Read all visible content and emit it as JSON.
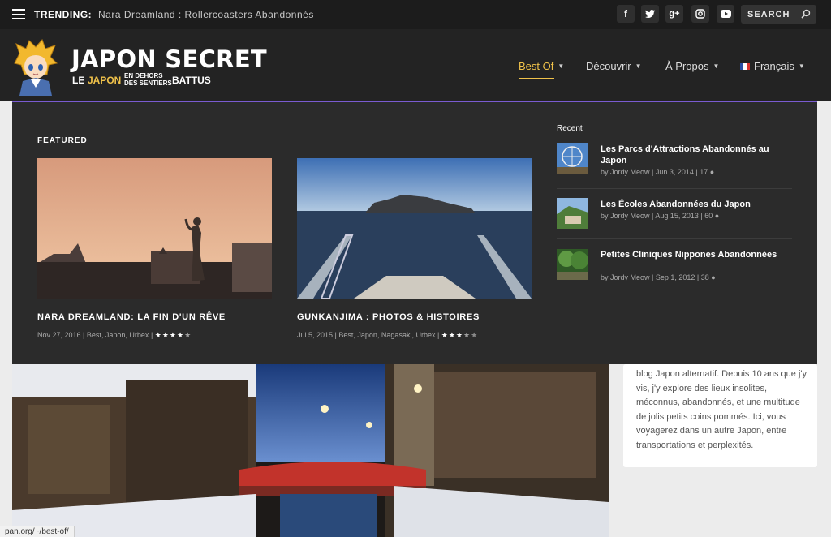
{
  "topbar": {
    "trending_label": "TRENDING:",
    "trending_text": "Nara Dreamland : Rollercoasters Abandonnés",
    "social": [
      "facebook-icon",
      "twitter-icon",
      "google-plus-icon",
      "instagram-icon",
      "youtube-icon"
    ],
    "search_placeholder": "SEARCH"
  },
  "brand": {
    "title": "JAPON SECRET",
    "tagline_le": "LE",
    "tagline_japon": "JAPON",
    "tagline_small_1": "EN DEHORS",
    "tagline_small_2": "DES SENTIERS",
    "tagline_battus": "BATTUS"
  },
  "nav": {
    "items": [
      {
        "label": "Best Of",
        "active": true
      },
      {
        "label": "Découvrir",
        "active": false
      },
      {
        "label": "À Propos",
        "active": false
      },
      {
        "label": "Français",
        "active": false
      }
    ]
  },
  "mega": {
    "featured_label": "FEATURED",
    "featured": [
      {
        "title": "NARA DREAMLAND: LA FIN D'UN RÊVE",
        "date": "Nov 27, 2016",
        "tags": "Best, Japon, Urbex",
        "rating": 4.5
      },
      {
        "title": "GUNKANJIMA : PHOTOS & HISTOIRES",
        "date": "Jul 5, 2015",
        "tags": "Best, Japon, Nagasaki, Urbex",
        "rating": 3.5
      }
    ],
    "recent_label": "Recent",
    "recent": [
      {
        "title": "Les Parcs d'Attractions Abandonnés au Japon",
        "meta": "by Jordy Meow | Jun 3, 2014 | 17"
      },
      {
        "title": "Les Écoles Abandonnées du Japon",
        "meta": "by Jordy Meow | Aug 15, 2013 | 60"
      },
      {
        "title": "Petites Cliniques Nippones Abandonnées",
        "meta": "by Jordy Meow | Sep 1, 2012 | 38"
      }
    ]
  },
  "sidebar": {
    "text": "blog Japon alternatif. Depuis 10 ans que j'y vis, j'y explore des lieux insolites, méconnus, abandonnés, et une multitude de jolis petits coins pommés. Ici, vous voyagerez dans un autre Japon, entre transportations et perplexités."
  },
  "status": {
    "url": "pan.org/~/best-of/"
  },
  "colors": {
    "accent": "#f0c24a",
    "menu_border": "#7a5bd1",
    "topbar_bg": "#1c1c1c",
    "header_bg": "#232323",
    "mega_bg": "#2b2b2b"
  }
}
